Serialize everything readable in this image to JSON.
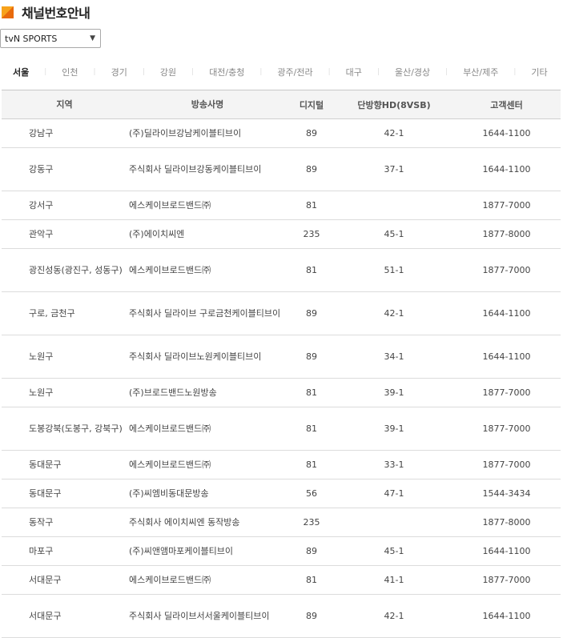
{
  "header": {
    "title": "채널번호안내"
  },
  "channel_select": {
    "value": "tvN SPORTS"
  },
  "tabs": [
    "서울",
    "인천",
    "경기",
    "강원",
    "대전/충청",
    "광주/전라",
    "대구",
    "울산/경상",
    "부산/제주",
    "기타"
  ],
  "table": {
    "headers": [
      "지역",
      "방송사명",
      "디지털",
      "단방향HD(8VSB)",
      "고객센터"
    ],
    "rows": [
      [
        "강남구",
        "(주)딜라이브강남케이블티브이",
        "89",
        "42-1",
        "1644-1100"
      ],
      [
        "강동구",
        "주식회사 딜라이브강동케이블티브이",
        "89",
        "37-1",
        "1644-1100"
      ],
      [
        "강서구",
        "에스케이브로드밴드㈜",
        "81",
        "",
        "1877-7000"
      ],
      [
        "관악구",
        "(주)에이치씨엔",
        "235",
        "45-1",
        "1877-8000"
      ],
      [
        "광진성동(광진구, 성동구)",
        "에스케이브로드밴드㈜",
        "81",
        "51-1",
        "1877-7000"
      ],
      [
        "구로, 금천구",
        "주식회사 딜라이브 구로금천케이블티브이",
        "89",
        "42-1",
        "1644-1100"
      ],
      [
        "노원구",
        "주식회사 딜라이브노원케이블티브이",
        "89",
        "34-1",
        "1644-1100"
      ],
      [
        "노원구",
        "(주)브로드밴드노원방송",
        "81",
        "39-1",
        "1877-7000"
      ],
      [
        "도봉강북(도봉구, 강북구)",
        "에스케이브로드밴드㈜",
        "81",
        "39-1",
        "1877-7000"
      ],
      [
        "동대문구",
        "에스케이브로드밴드㈜",
        "81",
        "33-1",
        "1877-7000"
      ],
      [
        "동대문구",
        "(주)씨엠비동대문방송",
        "56",
        "47-1",
        "1544-3434"
      ],
      [
        "동작구",
        "주식회사 에이치씨엔 동작방송",
        "235",
        "",
        "1877-8000"
      ],
      [
        "마포구",
        "(주)씨앤앰마포케이블티브이",
        "89",
        "45-1",
        "1644-1100"
      ],
      [
        "서대문구",
        "에스케이브로드밴드㈜",
        "81",
        "41-1",
        "1877-7000"
      ],
      [
        "서대문구",
        "주식회사 딜라이브서서울케이블티브이",
        "89",
        "42-1",
        "1644-1100"
      ]
    ]
  }
}
